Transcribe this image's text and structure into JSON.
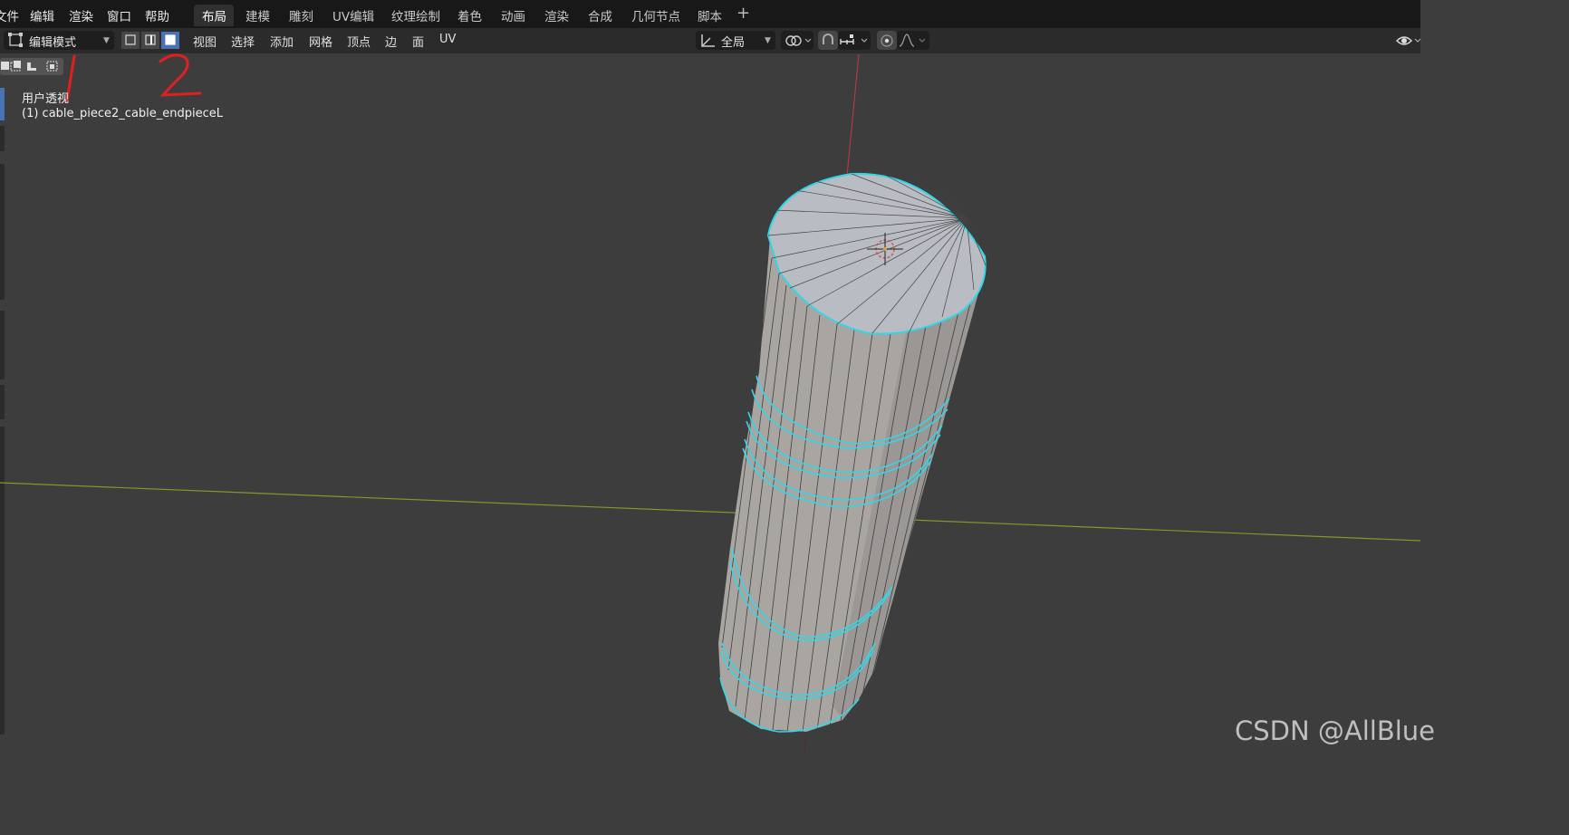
{
  "menubar": {
    "items": [
      "文件",
      "编辑",
      "渲染",
      "窗口",
      "帮助"
    ]
  },
  "workspaces": {
    "tabs": [
      "布局",
      "建模",
      "雕刻",
      "UV编辑",
      "纹理绘制",
      "着色",
      "动画",
      "渲染",
      "合成",
      "几何节点",
      "脚本"
    ],
    "active": "布局"
  },
  "header": {
    "mode": "编辑模式",
    "menus": [
      "视图",
      "选择",
      "添加",
      "网格",
      "顶点",
      "边",
      "面",
      "UV"
    ],
    "select_mode_active": "face",
    "transform_orientation": "全局"
  },
  "viewport": {
    "view_name": "用户透视",
    "object_name": "(1) cable_piece2_cable_endpieceL"
  },
  "annotations": [
    "1",
    "2"
  ],
  "watermark": "CSDN @AllBlue",
  "colors": {
    "accent": "#4772b3",
    "edge_highlight": "#33d6e8",
    "annotation": "#e02020",
    "x_axis": "#8aa32c",
    "z_axis": "#b83a44",
    "mesh_face": "#a8a8a8"
  }
}
